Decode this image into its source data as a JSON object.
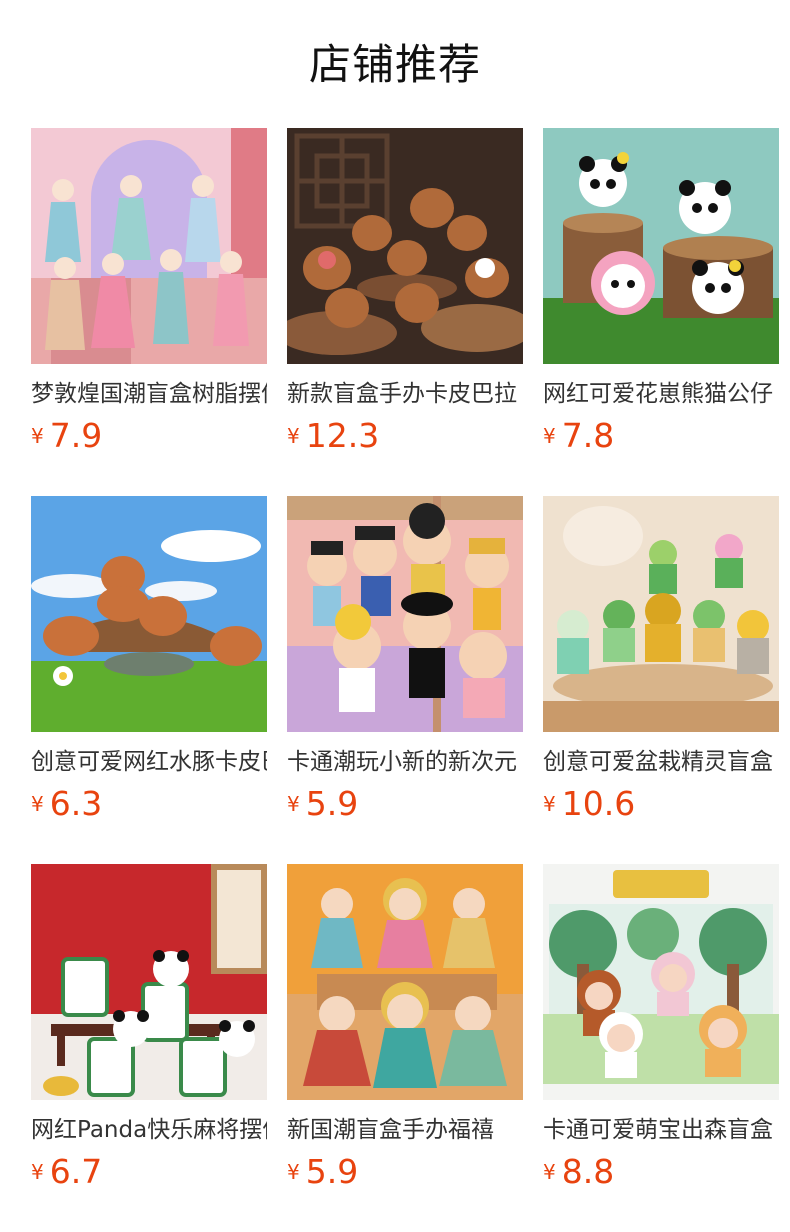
{
  "header": {
    "title": "店铺推荐"
  },
  "currency_symbol": "¥",
  "colors": {
    "price": "#e8430f",
    "title": "#111111",
    "name": "#333333"
  },
  "products": [
    {
      "name": "梦敦煌国潮盲盒树脂摆件",
      "price": "7.9",
      "image": "dunhuang-figurines-image"
    },
    {
      "name": "新款盲盒手办卡皮巴拉",
      "price": "12.3",
      "image": "capybara-figurines-image"
    },
    {
      "name": "网红可爱花崽熊猫公仔",
      "price": "7.8",
      "image": "panda-figurines-image"
    },
    {
      "name": "创意可爱网红水豚卡皮巴拉",
      "price": "6.3",
      "image": "capybara-meadow-image"
    },
    {
      "name": "卡通潮玩小新的新次元",
      "price": "5.9",
      "image": "crayon-shin-figurines-image"
    },
    {
      "name": "创意可爱盆栽精灵盲盒",
      "price": "10.6",
      "image": "plant-sprite-figurines-image"
    },
    {
      "name": "网红Panda快乐麻将摆件",
      "price": "6.7",
      "image": "panda-mahjong-image"
    },
    {
      "name": "新国潮盲盒手办福禧",
      "price": "5.9",
      "image": "guochao-figurines-image"
    },
    {
      "name": "卡通可爱萌宝出森盲盒",
      "price": "8.8",
      "image": "forest-baby-figurines-image"
    }
  ]
}
